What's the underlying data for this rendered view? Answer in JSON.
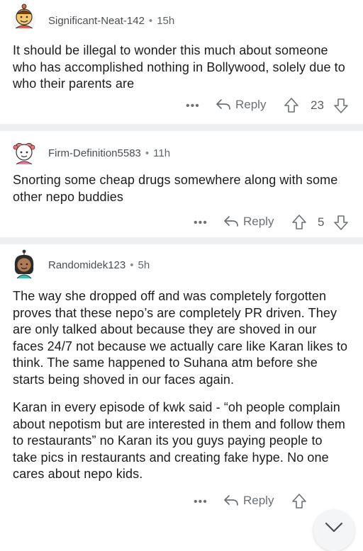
{
  "comments": [
    {
      "username": "Significant-Neat-142",
      "age": "15h",
      "avatar_icon": "snoo-avatar-icon",
      "paragraphs": [
        "It should be illegal to wonder this much about someone who has accomplished nothing in Bollywood, solely due to who their parents are"
      ],
      "more_label": "•••",
      "reply_label": "Reply",
      "score": "23"
    },
    {
      "username": "Firm-Definition5583",
      "age": "11h",
      "avatar_icon": "snoo-avatar-icon",
      "paragraphs": [
        "Snorting some cheap drugs somewhere along with some other nepo buddies"
      ],
      "more_label": "•••",
      "reply_label": "Reply",
      "score": "5"
    },
    {
      "username": "Randomidek123",
      "age": "5h",
      "avatar_icon": "snoo-avatar-icon",
      "paragraphs": [
        "The way she dropped off and was completely forgotten proves that these nepo’s are completely PR driven. They are only talked about because they are shoved in our faces 24/7 not because we actually care like Karan likes to think. The same happened to Suhana atm before she starts being shoved in our faces again.",
        "Karan in every episode of kwk said - “oh people complain about nepotism but are interested in them and follow them to restaurants” no Karan its you guys paying people to take pics in restaurants and creating fake hype. No one cares about nepo kids."
      ],
      "more_label": "•••",
      "reply_label": "Reply",
      "score": ""
    }
  ],
  "colors": {
    "separator": "#eeeff1",
    "muted_text": "#6c7074",
    "body_text": "#1c1c1c"
  },
  "scroll_button_icon": "chevron-down-icon"
}
